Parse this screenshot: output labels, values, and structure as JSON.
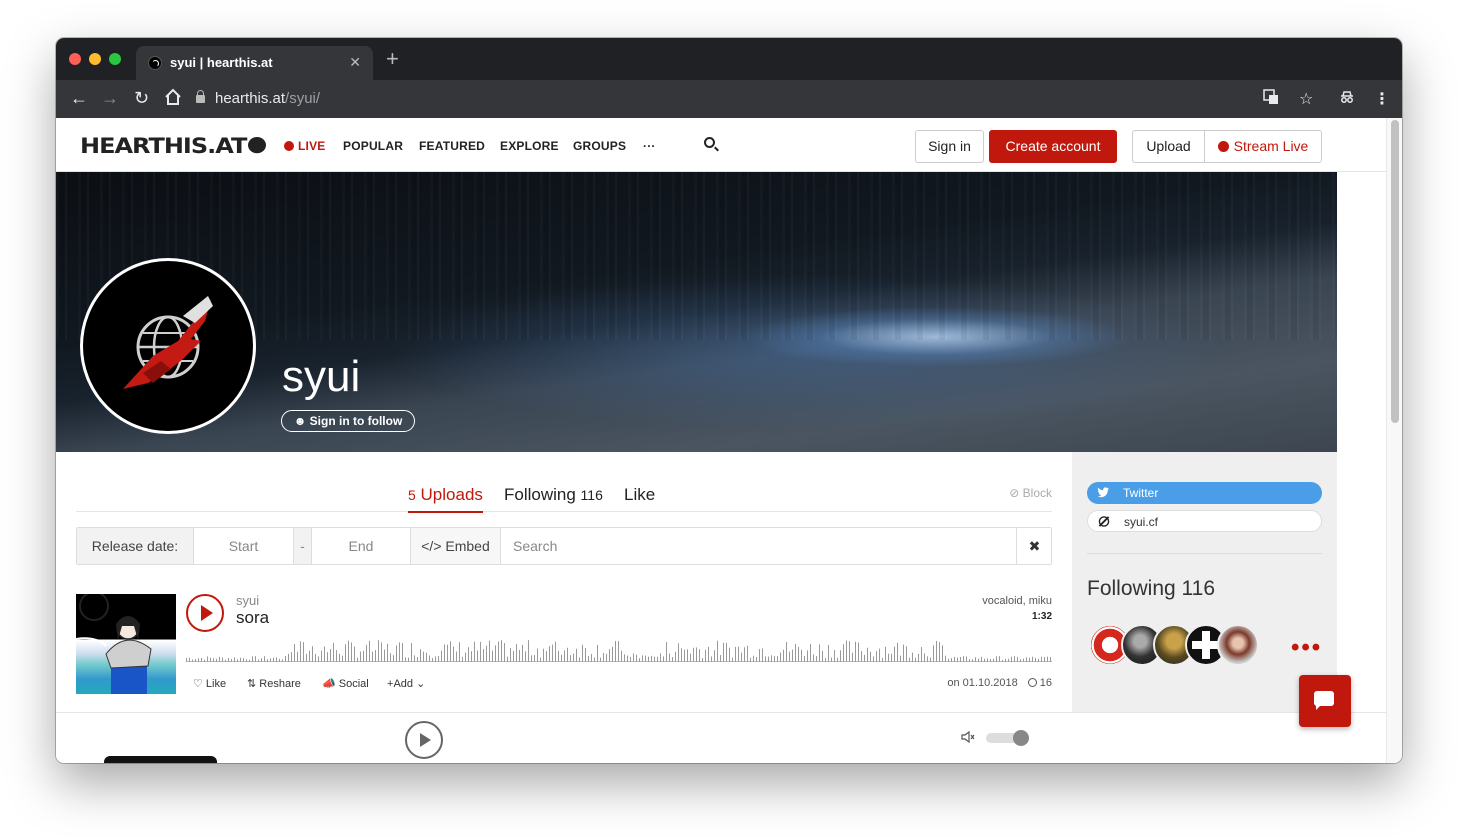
{
  "browser": {
    "tab_title": "syui | hearthis.at",
    "tab_close": "✕",
    "new_tab": "+",
    "url_host": "hearthis.at",
    "url_path": "/syui/"
  },
  "header": {
    "logo": "HEARTHIS.AT",
    "nav": [
      "LIVE",
      "POPULAR",
      "FEATURED",
      "EXPLORE",
      "GROUPS",
      "···"
    ],
    "sign_in": "Sign in",
    "create_account": "Create account",
    "upload": "Upload",
    "stream_live": "Stream Live"
  },
  "profile": {
    "username": "syui",
    "follow_button": "Sign in to follow"
  },
  "tabs": {
    "uploads_count": "5",
    "uploads_label": "Uploads",
    "following_label": "Following",
    "following_count": "116",
    "like_label": "Like",
    "block_label": "Block"
  },
  "filter": {
    "release_label": "Release date:",
    "start_placeholder": "Start",
    "dash": "-",
    "end_placeholder": "End",
    "embed_label": "Embed",
    "search_placeholder": "Search",
    "clear": "✖"
  },
  "track": {
    "user": "syui",
    "title": "sora",
    "tags": "vocaloid, miku",
    "duration": "1:32",
    "like": "Like",
    "reshare": "Reshare",
    "social": "Social",
    "add": "Add",
    "date": "on 01.10.2018",
    "plays": "16"
  },
  "sidebar": {
    "twitter": "Twitter",
    "website": "syui.cf",
    "following_title": "Following 116",
    "more": "•••"
  },
  "colors": {
    "accent": "#c0180c",
    "twitter": "#4a9ee8"
  }
}
